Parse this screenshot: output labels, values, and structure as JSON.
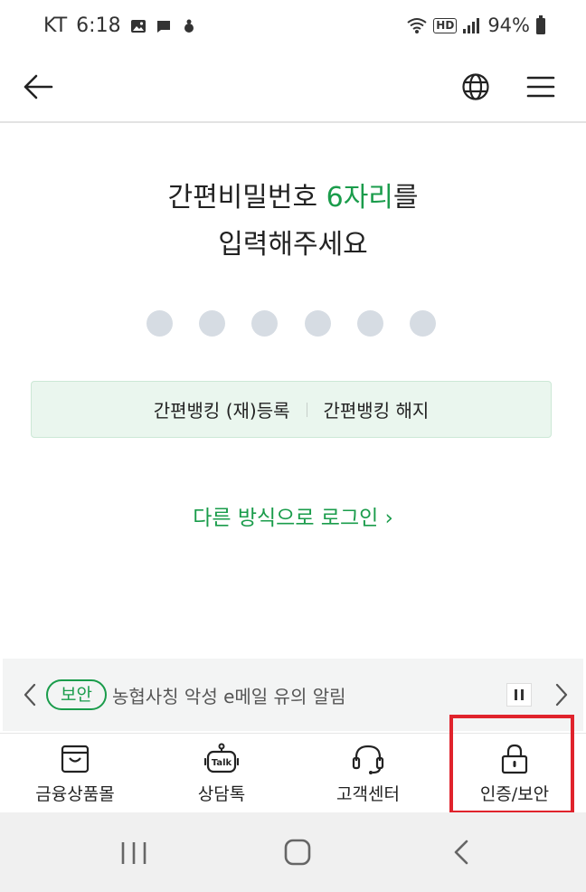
{
  "status_bar": {
    "carrier": "KT",
    "time": "6:18",
    "network_badge": "HD",
    "battery": "94%"
  },
  "header": {
    "back_icon": "arrow-left-icon",
    "globe_icon": "globe-icon",
    "menu_icon": "hamburger-menu-icon"
  },
  "prompt": {
    "line1_prefix": "간편비밀번호",
    "line1_highlight": "6자리",
    "line1_suffix": "를",
    "line2": "입력해주세요"
  },
  "pin": {
    "length": 6,
    "filled": 0
  },
  "registration": {
    "register_label": "간편뱅킹 (재)등록",
    "cancel_label": "간편뱅킹 해지"
  },
  "alt_login": {
    "label": "다른 방식으로 로그인 ›"
  },
  "notice": {
    "badge": "보안",
    "text": "농협사칭 악성 e메일 유의 알림"
  },
  "bottom_tabs": [
    {
      "label": "금융상품몰",
      "icon": "shopping-bag-icon"
    },
    {
      "label": "상담톡",
      "icon": "chatbot-talk-icon"
    },
    {
      "label": "고객센터",
      "icon": "headset-icon"
    },
    {
      "label": "인증/보안",
      "icon": "padlock-icon"
    }
  ],
  "colors": {
    "accent": "#1a9c4b",
    "highlight_box": "#e0232c",
    "pin_dot": "#d6dce3",
    "reg_box_bg": "#eaf6ee"
  }
}
